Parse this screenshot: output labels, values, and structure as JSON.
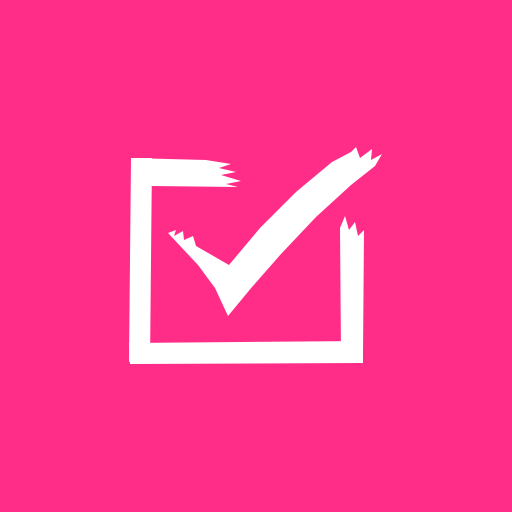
{
  "app_icon": {
    "icon_name": "checkbox-checked-icon",
    "colors": {
      "background": "#FF2D87",
      "foreground": "#FFFFFF"
    }
  }
}
